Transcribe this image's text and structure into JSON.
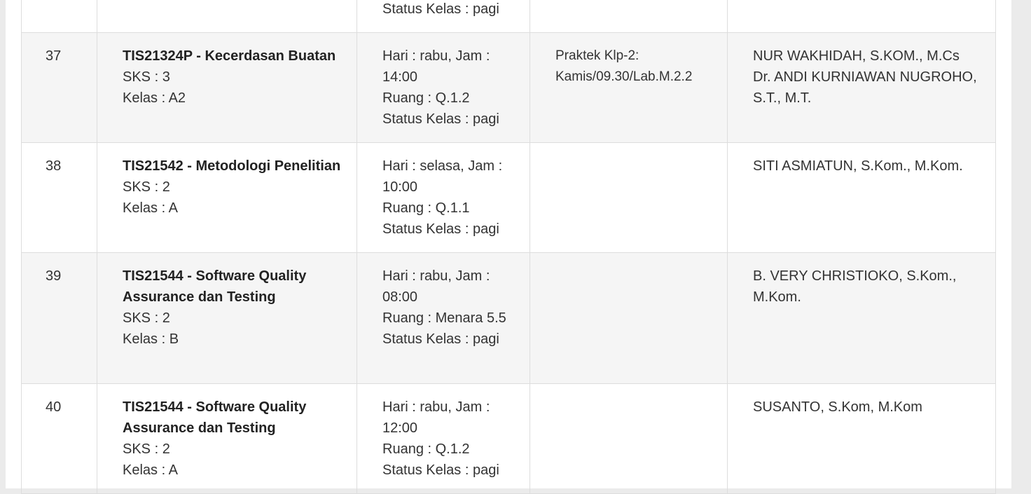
{
  "rows": [
    {
      "no": "",
      "title": "",
      "sks": "",
      "kelas": "",
      "schedule": [
        "Status Kelas : pagi"
      ],
      "notes": [],
      "lecturers": []
    },
    {
      "no": "37",
      "title": "TIS21324P - Kecerdasan Buatan",
      "sks": "SKS : 3",
      "kelas": "Kelas : A2",
      "schedule": [
        "Hari : rabu, Jam : 14:00",
        "Ruang : Q.1.2",
        "Status Kelas : pagi"
      ],
      "notes": [
        "Praktek Klp-2:",
        "Kamis/09.30/Lab.M.2.2"
      ],
      "lecturers": [
        "NUR WAKHIDAH, S.KOM., M.Cs",
        "Dr. ANDI KURNIAWAN NUGROHO, S.T., M.T."
      ]
    },
    {
      "no": "38",
      "title": "TIS21542 - Metodologi Penelitian",
      "sks": "SKS : 2",
      "kelas": "Kelas : A",
      "schedule": [
        "Hari : selasa, Jam : 10:00",
        "Ruang : Q.1.1",
        "Status Kelas : pagi"
      ],
      "notes": [],
      "lecturers": [
        "SITI ASMIATUN, S.Kom., M.Kom."
      ]
    },
    {
      "no": "39",
      "title": "TIS21544 - Software Quality Assurance dan Testing",
      "sks": "SKS : 2",
      "kelas": "Kelas : B",
      "schedule": [
        "Hari : rabu, Jam : 08:00",
        "Ruang : Menara 5.5",
        "Status Kelas : pagi"
      ],
      "notes": [],
      "lecturers": [
        "B. VERY CHRISTIOKO, S.Kom., M.Kom."
      ]
    },
    {
      "no": "40",
      "title": "TIS21544 - Software Quality Assurance dan Testing",
      "sks": "SKS : 2",
      "kelas": "Kelas : A",
      "schedule": [
        "Hari : rabu, Jam : 12:00",
        "Ruang : Q.1.2",
        "Status Kelas : pagi"
      ],
      "notes": [],
      "lecturers": [
        "SUSANTO, S.Kom, M.Kom"
      ]
    }
  ]
}
